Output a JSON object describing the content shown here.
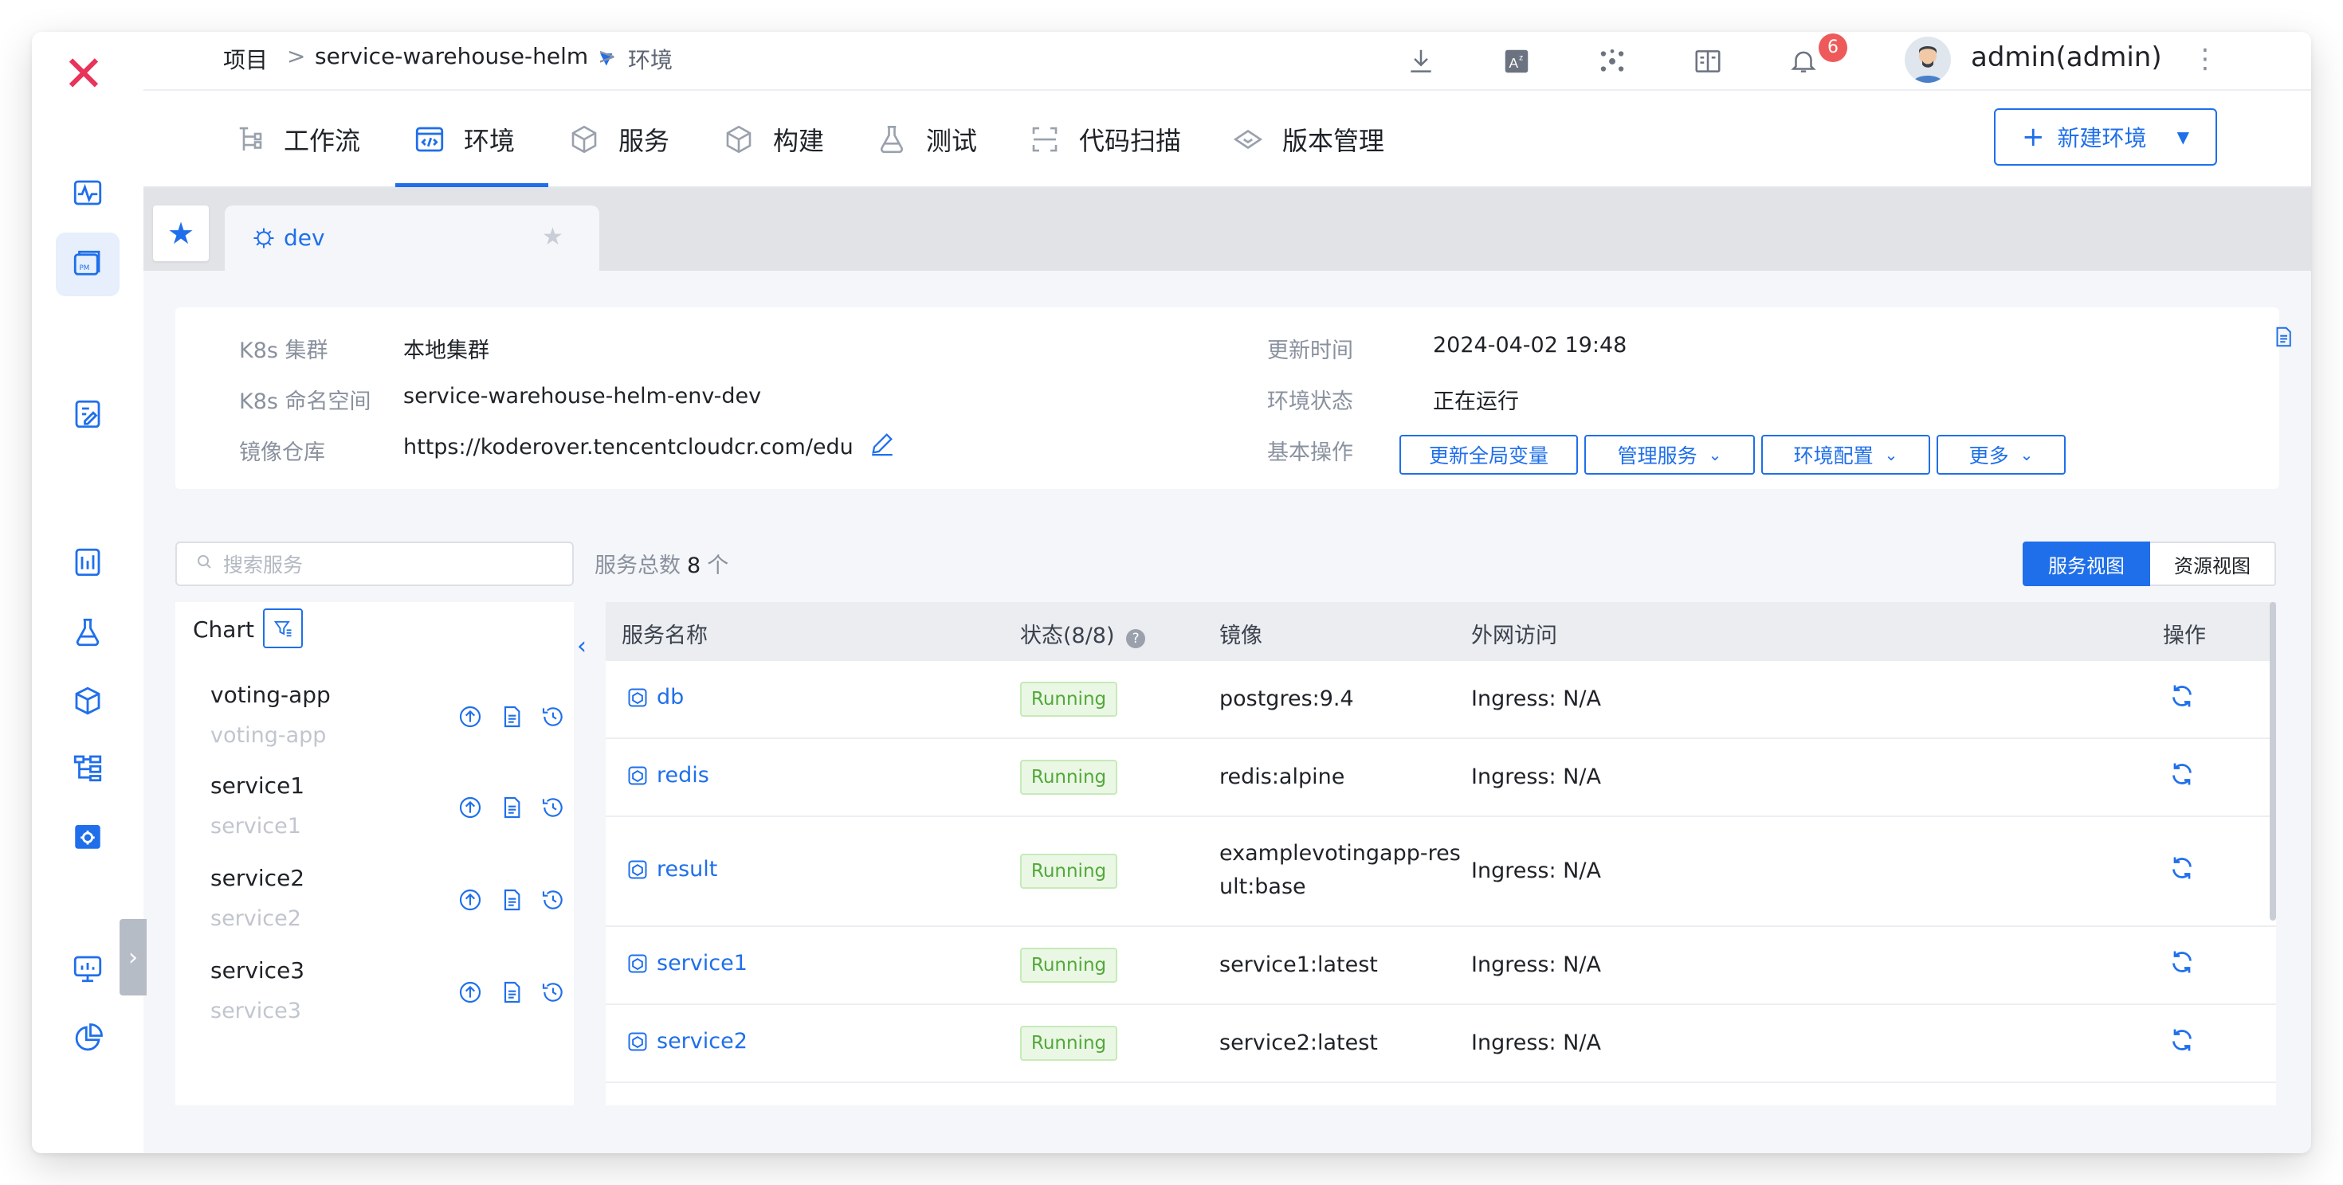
{
  "breadcrumb": {
    "root": "项目",
    "sep": ">",
    "project": "service-warehouse-helm",
    "current": "环境"
  },
  "notifications": {
    "count": "6"
  },
  "user": {
    "name": "admin(admin)"
  },
  "tabs": [
    {
      "label": "工作流",
      "icon": "workflow-icon"
    },
    {
      "label": "环境",
      "icon": "code-icon",
      "active": true
    },
    {
      "label": "服务",
      "icon": "service-icon"
    },
    {
      "label": "构建",
      "icon": "build-icon"
    },
    {
      "label": "测试",
      "icon": "test-icon"
    },
    {
      "label": "代码扫描",
      "icon": "scan-icon"
    },
    {
      "label": "版本管理",
      "icon": "version-icon"
    }
  ],
  "new_env_button": "新建环境",
  "env_tab": {
    "name": "dev"
  },
  "info": {
    "cluster_label": "K8s 集群",
    "cluster": "本地集群",
    "namespace_label": "K8s 命名空间",
    "namespace": "service-warehouse-helm-env-dev",
    "registry_label": "镜像仓库",
    "registry": "https://koderover.tencentcloudcr.com/edu",
    "updated_label": "更新时间",
    "updated": "2024-04-02 19:48",
    "status_label": "环境状态",
    "status": "正在运行",
    "ops_label": "基本操作",
    "ops": [
      "更新全局变量",
      "管理服务",
      "环境配置",
      "更多"
    ]
  },
  "search": {
    "placeholder": "搜索服务"
  },
  "total": {
    "label": "服务总数",
    "count": "8",
    "unit": "个"
  },
  "views": {
    "service_view": "服务视图",
    "resource_view": "资源视图"
  },
  "chart_panel": {
    "title": "Chart",
    "items": [
      {
        "name": "voting-app",
        "sub": "voting-app"
      },
      {
        "name": "service1",
        "sub": "service1"
      },
      {
        "name": "service2",
        "sub": "service2"
      },
      {
        "name": "service3",
        "sub": "service3"
      }
    ]
  },
  "table": {
    "headers": {
      "name": "服务名称",
      "status": "状态(8/8)",
      "image": "镜像",
      "access": "外网访问",
      "ops": "操作"
    },
    "rows": [
      {
        "name": "db",
        "status": "Running",
        "image": "postgres:9.4",
        "image2": "",
        "access": "Ingress: N/A"
      },
      {
        "name": "redis",
        "status": "Running",
        "image": "redis:alpine",
        "image2": "",
        "access": "Ingress: N/A"
      },
      {
        "name": "result",
        "status": "Running",
        "image": "examplevotingapp-res",
        "image2": "ult:base",
        "access": "Ingress: N/A"
      },
      {
        "name": "service1",
        "status": "Running",
        "image": "service1:latest",
        "image2": "",
        "access": "Ingress: N/A"
      },
      {
        "name": "service2",
        "status": "Running",
        "image": "service2:latest",
        "image2": "",
        "access": "Ingress: N/A"
      }
    ]
  },
  "colors": {
    "accent": "#1f6feb",
    "brand": "#e8335a",
    "running": "#53a83a"
  }
}
